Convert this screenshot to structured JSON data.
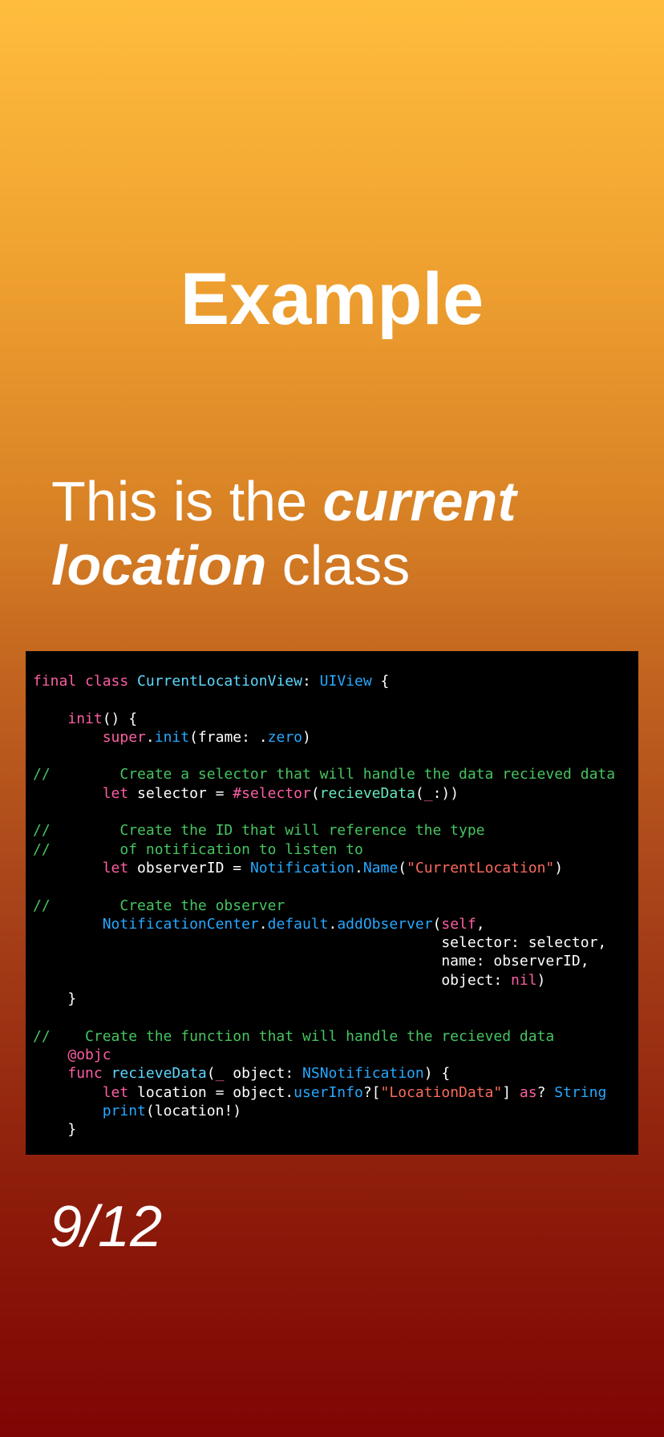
{
  "slide": {
    "title": "Example",
    "subtitle": {
      "part1": "This is the ",
      "emph1": "current",
      "part2": " ",
      "emph2": "location",
      "part3": " class"
    },
    "page_number": "9/12"
  },
  "code": {
    "lines": [
      [
        {
          "t": "final class ",
          "c": "kw"
        },
        {
          "t": "CurrentLocationView",
          "c": "type"
        },
        {
          "t": ": ",
          "c": "plain"
        },
        {
          "t": "UIView",
          "c": "sys"
        },
        {
          "t": " {",
          "c": "plain"
        }
      ],
      [],
      [
        {
          "t": "    ",
          "c": "plain"
        },
        {
          "t": "init",
          "c": "kw"
        },
        {
          "t": "() {",
          "c": "plain"
        }
      ],
      [
        {
          "t": "        ",
          "c": "plain"
        },
        {
          "t": "super",
          "c": "kw"
        },
        {
          "t": ".",
          "c": "plain"
        },
        {
          "t": "init",
          "c": "sys"
        },
        {
          "t": "(frame: .",
          "c": "plain"
        },
        {
          "t": "zero",
          "c": "sys"
        },
        {
          "t": ")",
          "c": "plain"
        }
      ],
      [],
      [
        {
          "t": "//        Create a selector that will handle the data recieved data",
          "c": "cmt"
        }
      ],
      [
        {
          "t": "        ",
          "c": "plain"
        },
        {
          "t": "let",
          "c": "kw"
        },
        {
          "t": " selector = ",
          "c": "plain"
        },
        {
          "t": "#selector",
          "c": "kw"
        },
        {
          "t": "(",
          "c": "plain"
        },
        {
          "t": "recieveData",
          "c": "fn"
        },
        {
          "t": "(",
          "c": "plain"
        },
        {
          "t": "_",
          "c": "kw"
        },
        {
          "t": ":))",
          "c": "plain"
        }
      ],
      [],
      [
        {
          "t": "//        Create the ID that will reference the type",
          "c": "cmt"
        }
      ],
      [
        {
          "t": "//        of notification to listen to",
          "c": "cmt"
        }
      ],
      [
        {
          "t": "        ",
          "c": "plain"
        },
        {
          "t": "let",
          "c": "kw"
        },
        {
          "t": " observerID = ",
          "c": "plain"
        },
        {
          "t": "Notification",
          "c": "sys"
        },
        {
          "t": ".",
          "c": "plain"
        },
        {
          "t": "Name",
          "c": "sys"
        },
        {
          "t": "(",
          "c": "plain"
        },
        {
          "t": "\"CurrentLocation\"",
          "c": "str"
        },
        {
          "t": ")",
          "c": "plain"
        }
      ],
      [],
      [
        {
          "t": "//        Create the observer",
          "c": "cmt"
        }
      ],
      [
        {
          "t": "        ",
          "c": "plain"
        },
        {
          "t": "NotificationCenter",
          "c": "sys"
        },
        {
          "t": ".",
          "c": "plain"
        },
        {
          "t": "default",
          "c": "sys"
        },
        {
          "t": ".",
          "c": "plain"
        },
        {
          "t": "addObserver",
          "c": "sys"
        },
        {
          "t": "(",
          "c": "plain"
        },
        {
          "t": "self",
          "c": "kw"
        },
        {
          "t": ",",
          "c": "plain"
        }
      ],
      [
        {
          "t": "                                               selector: selector,",
          "c": "plain"
        }
      ],
      [
        {
          "t": "                                               name: observerID,",
          "c": "plain"
        }
      ],
      [
        {
          "t": "                                               object: ",
          "c": "plain"
        },
        {
          "t": "nil",
          "c": "kw"
        },
        {
          "t": ")",
          "c": "plain"
        }
      ],
      [
        {
          "t": "    }",
          "c": "plain"
        }
      ],
      [],
      [
        {
          "t": "//    Create the function that will handle the recieved data",
          "c": "cmt"
        }
      ],
      [
        {
          "t": "    ",
          "c": "plain"
        },
        {
          "t": "@objc",
          "c": "kw"
        }
      ],
      [
        {
          "t": "    ",
          "c": "plain"
        },
        {
          "t": "func",
          "c": "kw"
        },
        {
          "t": " ",
          "c": "plain"
        },
        {
          "t": "recieveData",
          "c": "type"
        },
        {
          "t": "(",
          "c": "plain"
        },
        {
          "t": "_",
          "c": "kw"
        },
        {
          "t": " object: ",
          "c": "plain"
        },
        {
          "t": "NSNotification",
          "c": "sys"
        },
        {
          "t": ") {",
          "c": "plain"
        }
      ],
      [
        {
          "t": "        ",
          "c": "plain"
        },
        {
          "t": "let",
          "c": "kw"
        },
        {
          "t": " location = object.",
          "c": "plain"
        },
        {
          "t": "userInfo",
          "c": "sys"
        },
        {
          "t": "?[",
          "c": "plain"
        },
        {
          "t": "\"LocationData\"",
          "c": "str"
        },
        {
          "t": "] ",
          "c": "plain"
        },
        {
          "t": "as",
          "c": "kw"
        },
        {
          "t": "? ",
          "c": "plain"
        },
        {
          "t": "String",
          "c": "sys"
        }
      ],
      [
        {
          "t": "        ",
          "c": "plain"
        },
        {
          "t": "print",
          "c": "sys"
        },
        {
          "t": "(location!)",
          "c": "plain"
        }
      ],
      [
        {
          "t": "    }",
          "c": "plain"
        }
      ]
    ]
  },
  "colors": {
    "keyword": "#fc5fa3",
    "type": "#5dd8ff",
    "system": "#26a8ff",
    "comment": "#46c461",
    "string": "#fc6a5d",
    "function": "#67e8c0",
    "code_background": "#000000"
  }
}
